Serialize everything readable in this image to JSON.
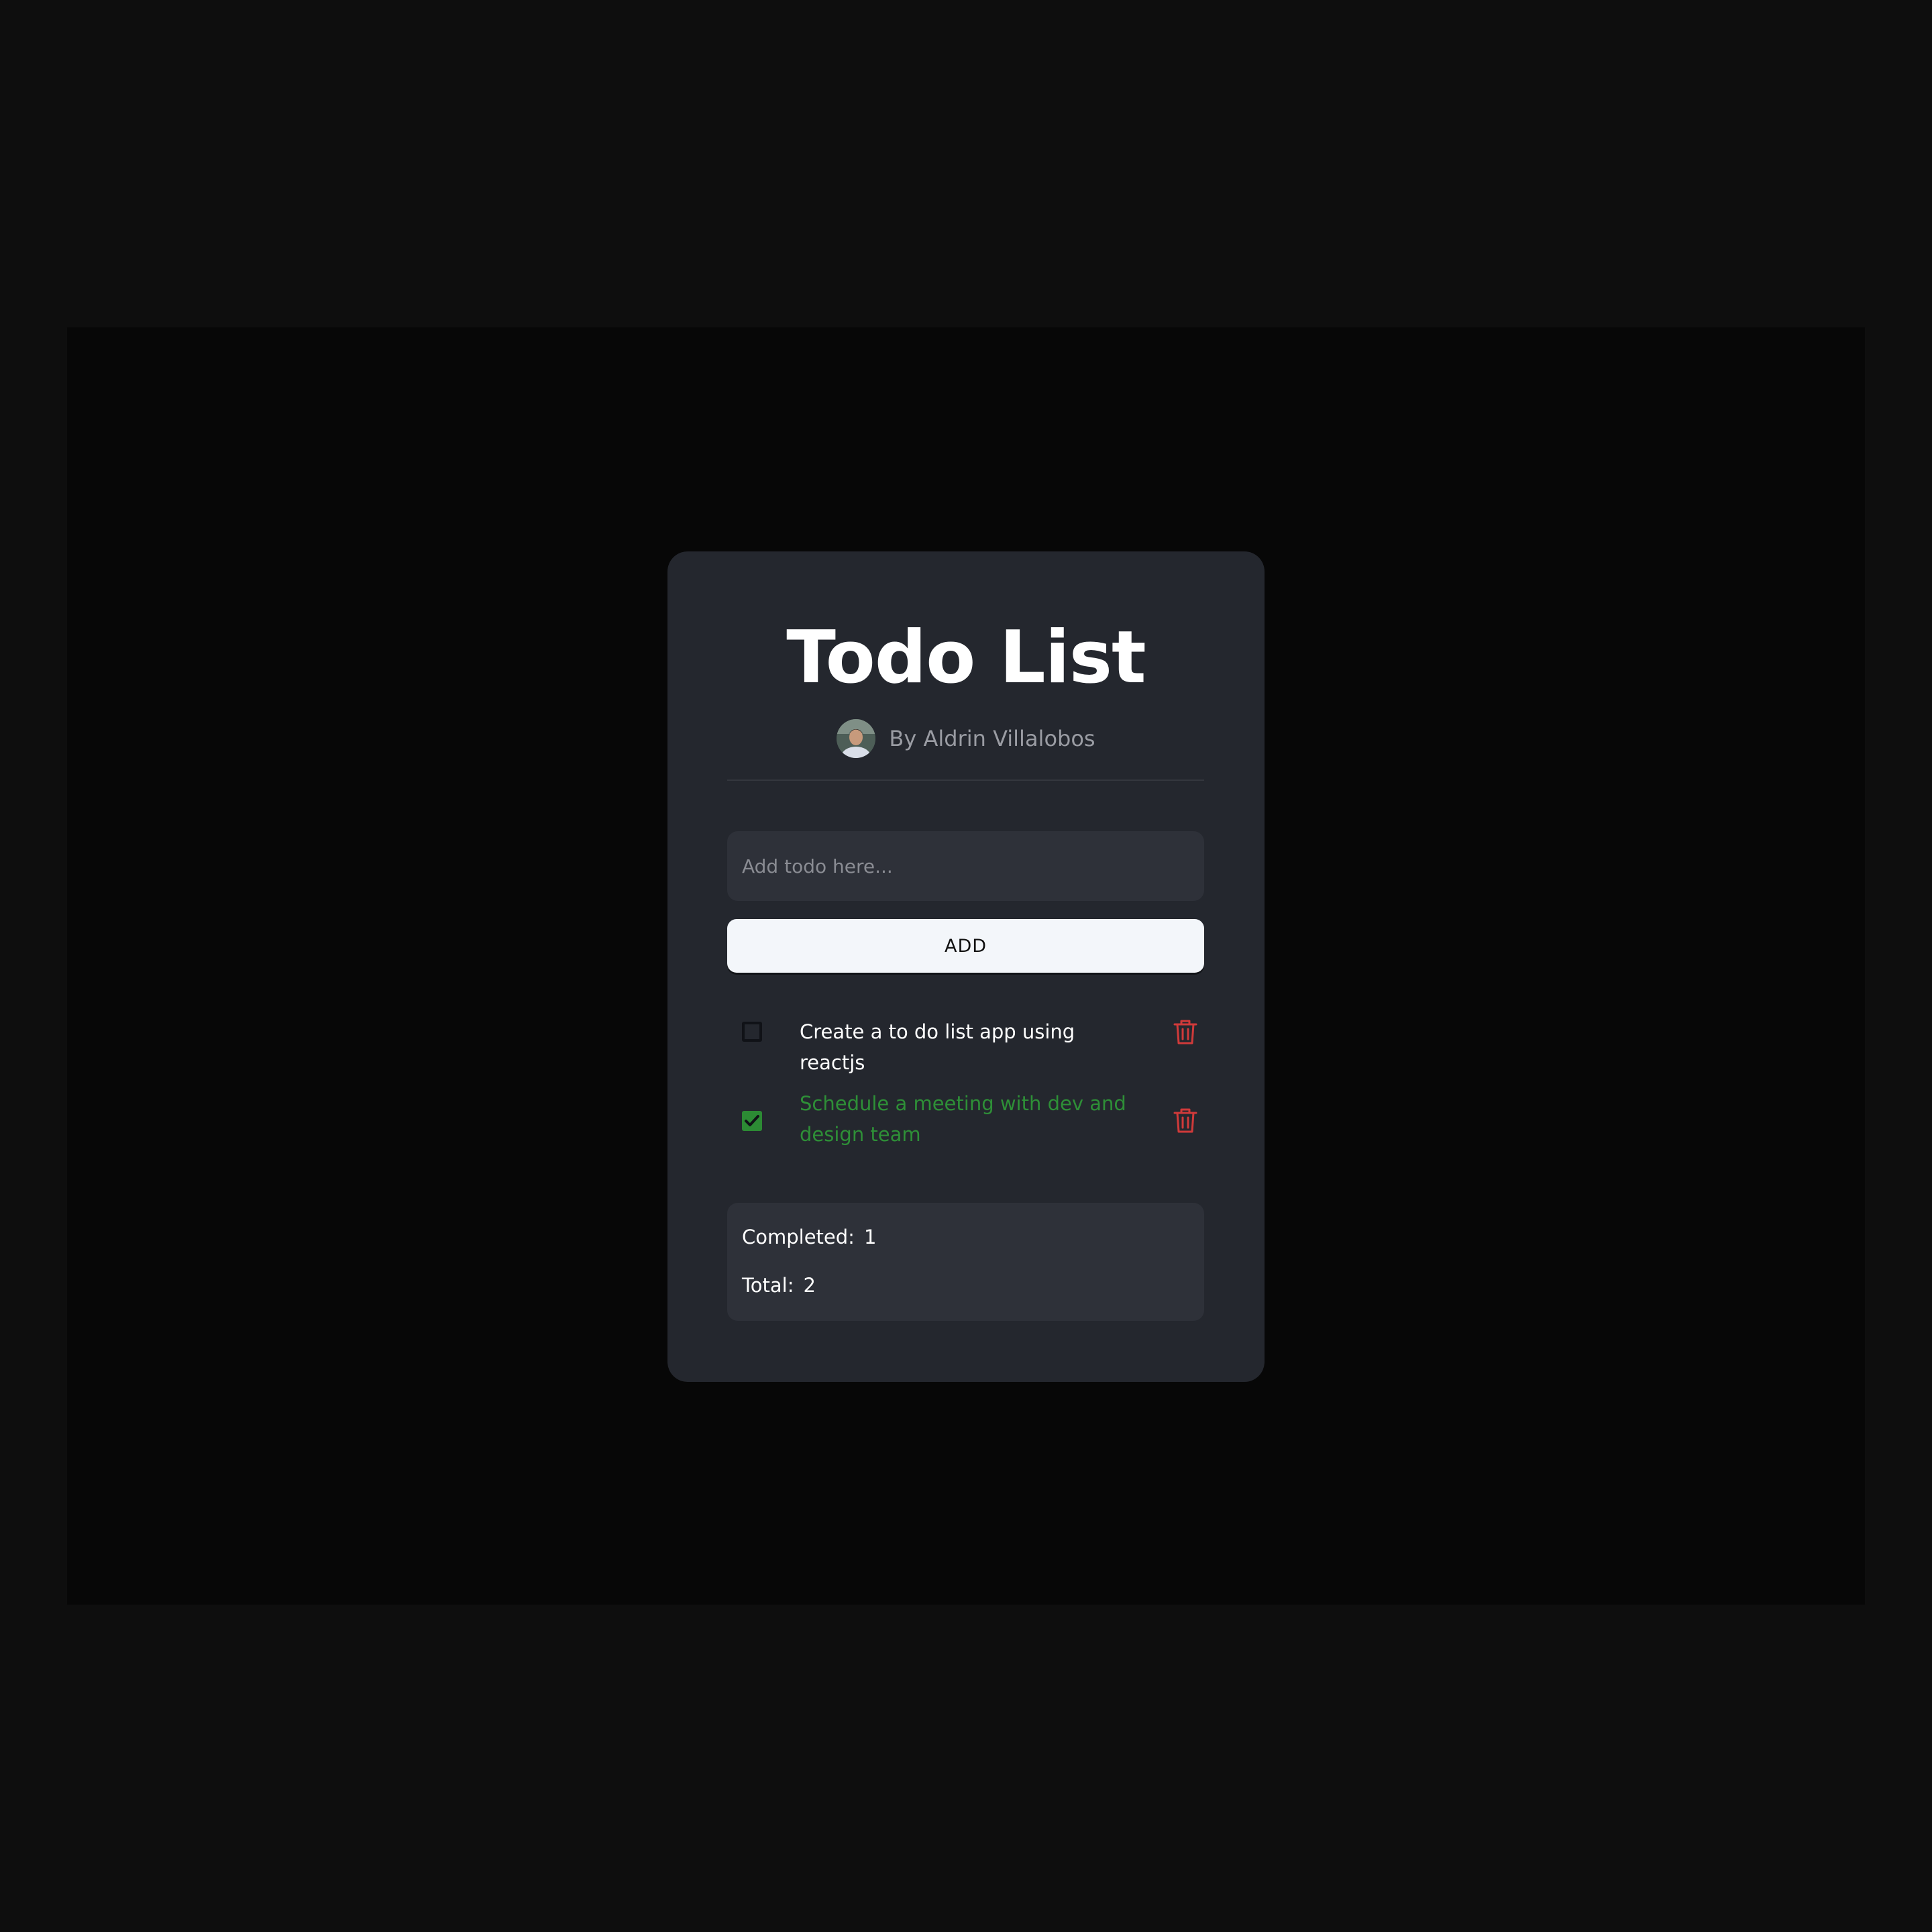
{
  "app": {
    "title": "Todo List",
    "author": "By Aldrin Villalobos"
  },
  "input": {
    "placeholder": "Add todo here...",
    "value": ""
  },
  "add_button": {
    "label": "ADD"
  },
  "todos": [
    {
      "text": "Create a to do list app using reactjs",
      "completed": false
    },
    {
      "text": "Schedule a meeting with dev and design team",
      "completed": true
    }
  ],
  "stats": {
    "completed_label": "Completed:",
    "completed_value": "1",
    "total_label": "Total:",
    "total_value": "2"
  },
  "colors": {
    "background": "#0e0e0e",
    "card": "#24272e",
    "field": "#2e3139",
    "completed_green": "#2e8f37",
    "delete_red": "#d03a3a",
    "button_bg": "#f3f6fa"
  },
  "icons": {
    "avatar": "author-avatar",
    "check": "check-icon",
    "delete": "trash-icon"
  }
}
